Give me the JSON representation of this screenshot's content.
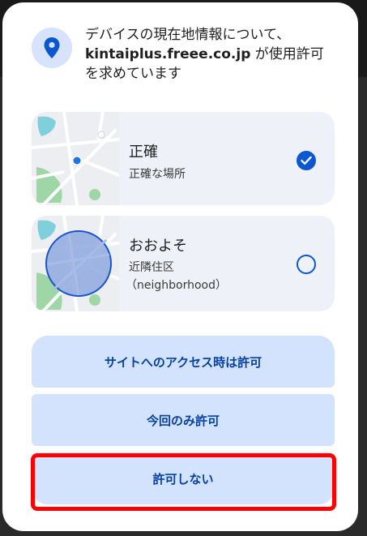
{
  "prompt": {
    "line1": "デバイスの現在地情報について、",
    "domain": "kintaiplus.freee.co.jp",
    "line2_suffix": " が使用許可",
    "line3": "を求めています",
    "icon": "location-pin-icon"
  },
  "options": {
    "precise": {
      "title": "正確",
      "subtitle": "正確な場所",
      "selected": true
    },
    "approximate": {
      "title": "おおよそ",
      "subtitle_line1": "近隣住区",
      "subtitle_line2": "（neighborhood）",
      "selected": false
    }
  },
  "buttons": {
    "allow_while_visiting": "サイトへのアクセス時は許可",
    "allow_once": "今回のみ許可",
    "deny": "許可しない"
  },
  "colors": {
    "accent": "#0b57d0",
    "button_bg": "#d3e3fd",
    "button_text": "#0842a0",
    "highlight": "#ff0000"
  }
}
